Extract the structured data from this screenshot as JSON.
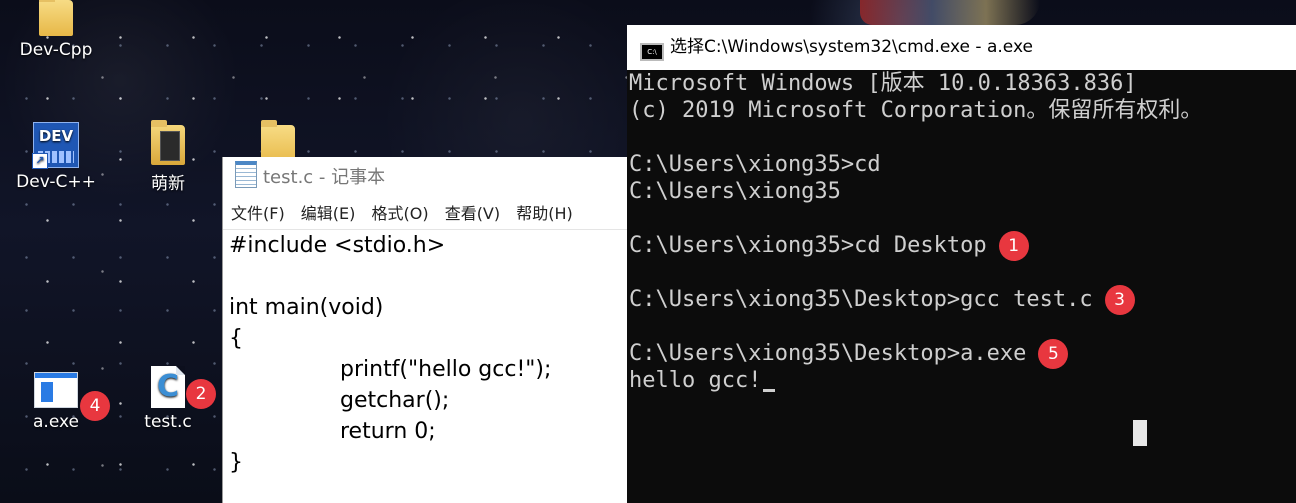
{
  "desktop": {
    "icons": [
      {
        "label": "Dev-Cpp"
      },
      {
        "label": "Dev-C++"
      },
      {
        "label": "萌新"
      },
      {
        "label": "a.exe"
      },
      {
        "label": "test.c"
      }
    ],
    "badges": [
      "4",
      "2"
    ]
  },
  "notepad": {
    "title": "test.c - 记事本",
    "menu": [
      "文件(F)",
      "编辑(E)",
      "格式(O)",
      "查看(V)",
      "帮助(H)"
    ],
    "lines": [
      "#include <stdio.h>",
      "",
      "int main(void)",
      "{",
      "printf(\"hello gcc!\");",
      "getchar();",
      "return 0;",
      "}"
    ]
  },
  "console": {
    "title": "选择C:\\Windows\\system32\\cmd.exe - a.exe",
    "icon_text": "C:\\",
    "lines": [
      "Microsoft Windows [版本 10.0.18363.836]",
      "(c) 2019 Microsoft Corporation。保留所有权利。",
      "",
      "C:\\Users\\xiong35>cd",
      "C:\\Users\\xiong35",
      "",
      "C:\\Users\\xiong35>cd Desktop",
      "",
      "C:\\Users\\xiong35\\Desktop>gcc test.c",
      "",
      "C:\\Users\\xiong35\\Desktop>a.exe",
      "hello gcc!"
    ],
    "badges": {
      "cd_desktop": "1",
      "gcc": "3",
      "aexe": "5"
    }
  },
  "colors": {
    "badge": "#e8373f",
    "console_bg": "#0c0c0c",
    "console_text": "#cfcfcf"
  }
}
